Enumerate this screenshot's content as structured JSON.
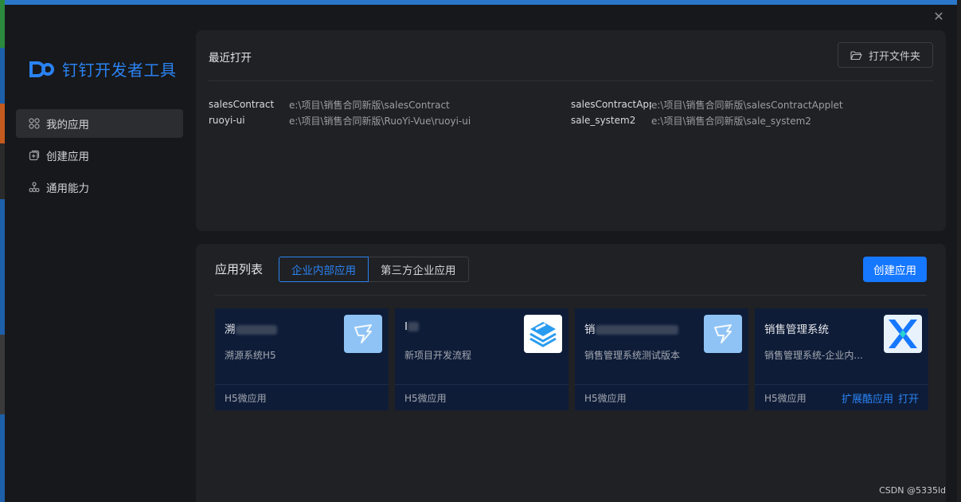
{
  "window": {
    "close_symbol": "✕"
  },
  "app": {
    "name": "钉钉开发者工具"
  },
  "nav": [
    {
      "label": "我的应用",
      "icon": "grid-icon",
      "active": true
    },
    {
      "label": "创建应用",
      "icon": "add-square-icon",
      "active": false
    },
    {
      "label": "通用能力",
      "icon": "cluster-icon",
      "active": false
    }
  ],
  "recent": {
    "title": "最近打开",
    "open_folder_label": "打开文件夹",
    "items": [
      {
        "name": "salesContract",
        "path": "e:\\项目\\销售合同新版\\salesContract"
      },
      {
        "name": "ruoyi-ui",
        "path": "e:\\项目\\销售合同新版\\RuoYi-Vue\\ruoyi-ui"
      },
      {
        "name": "salesContractAppl",
        "path": "e:\\项目\\销售合同新版\\salesContractApplet"
      },
      {
        "name": "sale_system2",
        "path": "e:\\项目\\销售合同新版\\sale_system2"
      }
    ]
  },
  "apps": {
    "title": "应用列表",
    "tabs": [
      "企业内部应用",
      "第三方企业应用"
    ],
    "create_label": "创建应用",
    "cards": [
      {
        "name": "溯",
        "desc": "溯源系统H5",
        "type": "H5微应用",
        "icon": "dingtalk-default-icon",
        "actions": []
      },
      {
        "name": "I",
        "desc": "新项目开发流程",
        "type": "H5微应用",
        "icon": "stack-layers-icon",
        "actions": []
      },
      {
        "name": "销",
        "desc": "销售管理系统测试版本",
        "type": "H5微应用",
        "icon": "dingtalk-default-icon",
        "actions": []
      },
      {
        "name": "销售管理系统",
        "desc": "销售管理系统-企业内...",
        "type": "H5微应用",
        "icon": "x-logo-icon",
        "actions": [
          "扩展酷应用",
          "打开"
        ]
      }
    ]
  },
  "watermark": "CSDN @5335ld",
  "colors": {
    "accent": "#1677ff",
    "card_bg": "#0e1c38",
    "window_bg": "#17181b",
    "panel_bg": "#202124"
  }
}
